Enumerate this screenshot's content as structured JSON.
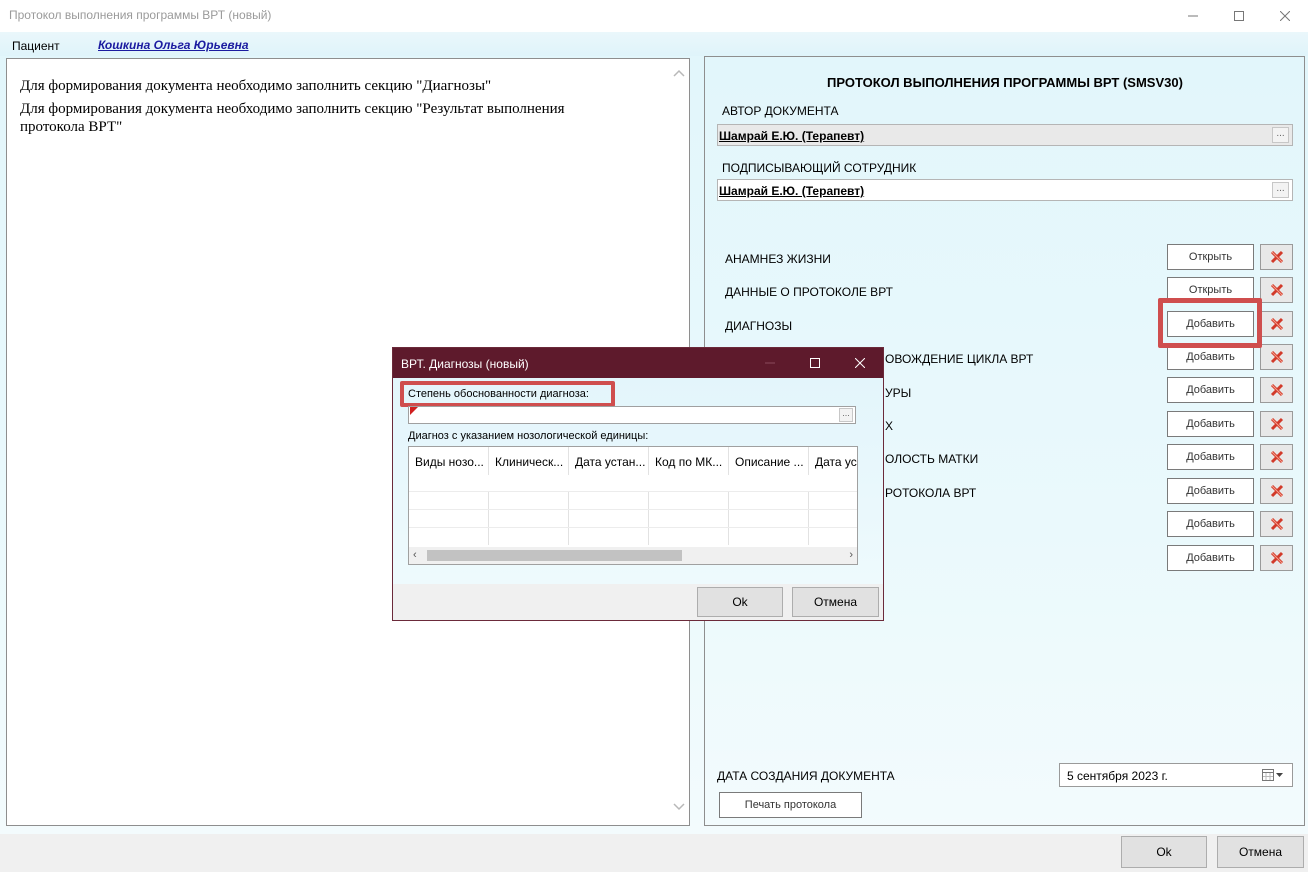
{
  "window": {
    "title": "Протокол выполнения программы ВРТ (новый)"
  },
  "patient": {
    "label": "Пациент",
    "name": "Кошкина Ольга Юрьевна"
  },
  "left_pane": {
    "messages": [
      "Для формирования документа необходимо заполнить секцию \"Диагнозы\"",
      "Для формирования документа необходимо заполнить секцию \"Результат выполнения протокола ВРТ\""
    ]
  },
  "right_pane": {
    "title": "ПРОТОКОЛ ВЫПОЛНЕНИЯ ПРОГРАММЫ ВРТ (SMSV30)",
    "author_label": "АВТОР ДОКУМЕНТА",
    "author_value": "Шамрай Е.Ю. (Терапевт)",
    "signer_label": "ПОДПИСЫВАЮЩИЙ СОТРУДНИК",
    "signer_value": "Шамрай Е.Ю. (Терапевт)",
    "dots": "...",
    "sections": [
      {
        "label": "АНАМНЕЗ ЖИЗНИ",
        "button": "Открыть"
      },
      {
        "label": "ДАННЫЕ О ПРОТОКОЛЕ ВРТ",
        "button": "Открыть"
      },
      {
        "label": "ДИАГНОЗЫ",
        "button": "Добавить"
      },
      {
        "label": "ОВОЖДЕНИЕ ЦИКЛА ВРТ",
        "button": "Добавить"
      },
      {
        "label": "УРЫ",
        "button": "Добавить"
      },
      {
        "label": "Х",
        "button": "Добавить"
      },
      {
        "label": "ОЛОСТЬ МАТКИ",
        "button": "Добавить"
      },
      {
        "label": "РОТОКОЛА ВРТ",
        "button": "Добавить"
      },
      {
        "label": "",
        "button": "Добавить"
      },
      {
        "label": "",
        "button": "Добавить"
      }
    ],
    "date_label": "ДАТА СОЗДАНИЯ ДОКУМЕНТА",
    "date_value": "5 сентября 2023 г.",
    "print_button": "Печать протокола"
  },
  "footer": {
    "ok": "Ok",
    "cancel": "Отмена"
  },
  "dialog": {
    "title": "ВРТ. Диагнозы (новый)",
    "field1_label": "Степень обоснованности диагноза:",
    "dots": "...",
    "grid_label": "Диагноз с указанием нозологической единицы:",
    "columns": [
      "Виды нозо...",
      "Клиническ...",
      "Дата устан...",
      "Код по МК...",
      "Описание ...",
      "Дата ус"
    ],
    "ok": "Ok",
    "cancel": "Отмена"
  }
}
